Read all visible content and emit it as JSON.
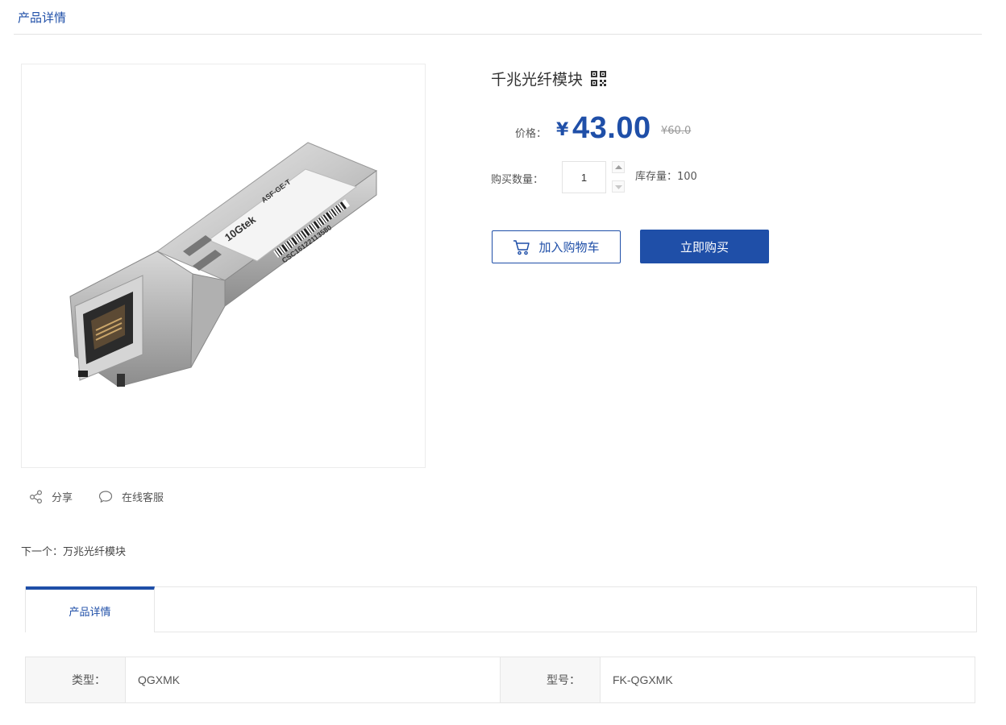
{
  "breadcrumb": {
    "label": "产品详情"
  },
  "product": {
    "title": "千兆光纤模块",
    "price_label": "价格：",
    "currency_symbol": "¥",
    "price": "43.00",
    "old_price": "¥60.0",
    "qty_label": "购买数量：",
    "qty_value": "1",
    "stock": "库存量：100",
    "module_labels": {
      "brand": "10Gtek",
      "model": "ASF-GE-T",
      "serial": "CSC16122113580"
    }
  },
  "buttons": {
    "add_to_cart": "加入购物车",
    "buy_now": "立即购买"
  },
  "actions": {
    "share": "分享",
    "online_service": "在线客服"
  },
  "next": "下一个：万兆光纤模块",
  "tabs": [
    {
      "label": "产品详情"
    }
  ],
  "specs": {
    "type_label": "类型：",
    "type_value": "QGXMK",
    "model_label": "型号：",
    "model_value": "FK-QGXMK"
  },
  "colors": {
    "accent": "#1f4fa8",
    "border": "#e6e6e6",
    "muted": "#999999"
  },
  "icons": [
    "qrcode-icon",
    "cart-icon",
    "share-icon",
    "chat-icon",
    "caret-up-icon",
    "caret-down-icon"
  ]
}
